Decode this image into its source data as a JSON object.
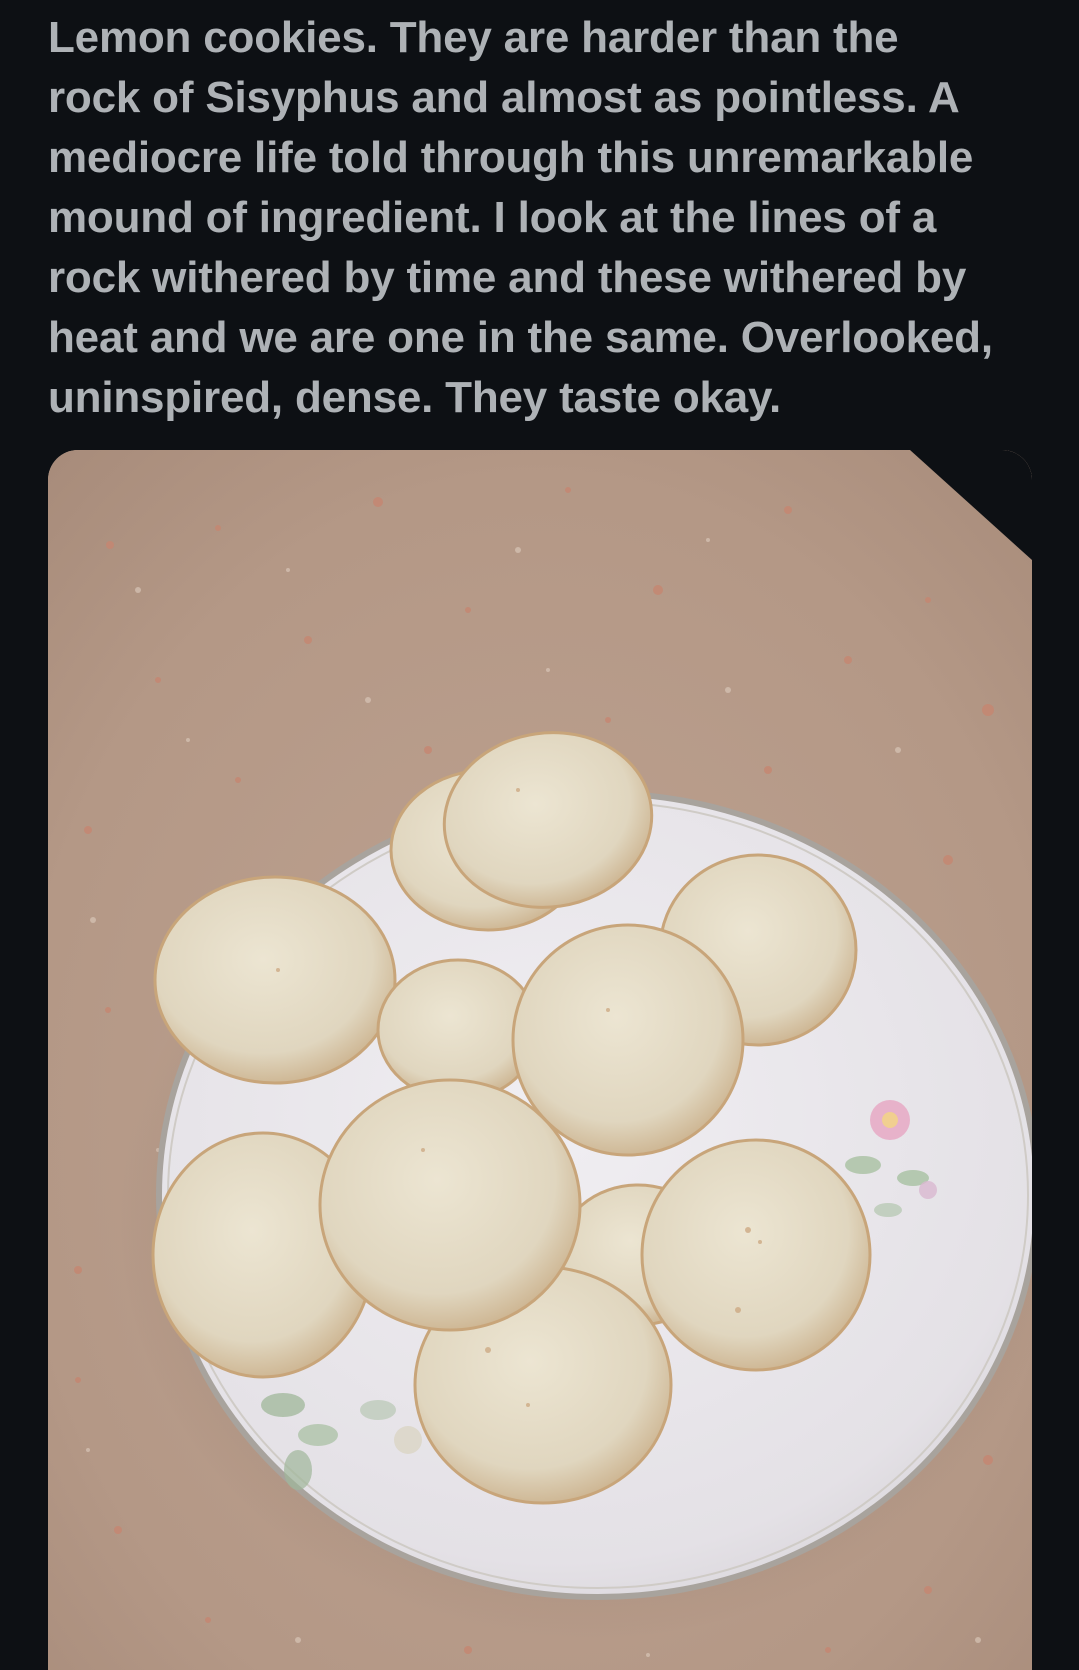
{
  "tweet": {
    "text": "Lemon cookies. They are harder than the\nrock of Sisyphus and almost as pointless. A\nmediocre life told through this unremarkable\nmound of ingredient. I look at the lines of a\nrock withered by time and these withered by\nheat and we are one in the same. Overlooked,\nuninspired, dense. They taste okay."
  },
  "media": {
    "description_icon": "photo",
    "colors": {
      "countertop": "#b89c8a",
      "plate": "#e9e7ea",
      "plate_rim": "#9a958f",
      "cookie": "#e2d9c3",
      "cookie_edge": "#c9a77f"
    }
  }
}
